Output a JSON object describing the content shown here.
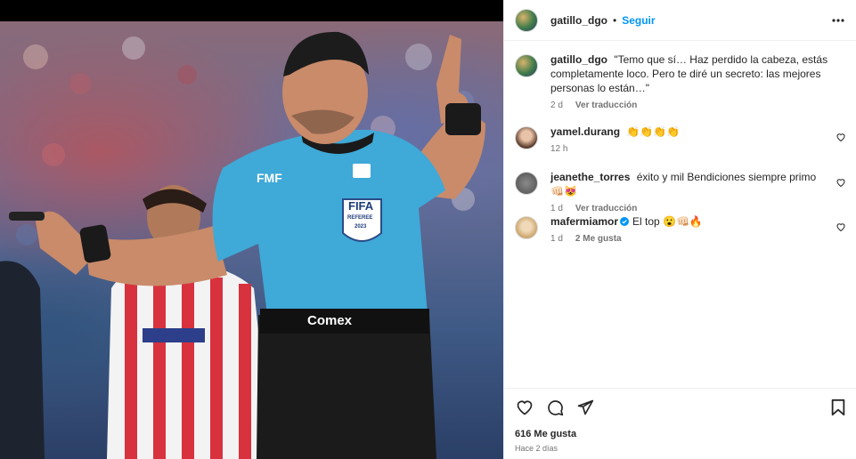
{
  "post": {
    "username": "gatillo_dgo",
    "separator": "•",
    "follow_label": "Seguir"
  },
  "photo": {
    "shirt_badge_text": "FMF",
    "fifa_badge": "FIFA",
    "referee_text": "REFEREE",
    "badge_year": "2023",
    "sponsor": "Comex"
  },
  "caption": {
    "username": "gatillo_dgo",
    "text": "\"Temo que sí… Haz perdido la cabeza, estás completamente loco. Pero te diré un secreto: las mejores personas lo están…\"",
    "age": "2 d",
    "translate_label": "Ver traducción"
  },
  "comments": [
    {
      "username": "yamel.durang",
      "text": "👏👏👏👏",
      "age": "12 h"
    },
    {
      "username": "jeanethe_torres",
      "text": "éxito y mil Bendiciones siempre primo 👊🏻😻",
      "age": "1 d",
      "translate_label": "Ver traducción"
    },
    {
      "username": "mafermiamor",
      "verified": true,
      "text": "El top 😮👊🏻🔥",
      "age": "1 d",
      "likes_label": "2 Me gusta"
    }
  ],
  "footer": {
    "likes": "616 Me gusta",
    "time": "Hace 2 días"
  },
  "icons": {
    "more": "more-options-icon",
    "heart": "heart-icon",
    "comment": "comment-icon",
    "share": "share-icon",
    "save": "bookmark-icon",
    "verified": "verified-badge-icon"
  },
  "colors": {
    "accent": "#0095f6",
    "text": "#262626",
    "secondary_text": "#737373",
    "border": "#efefef",
    "referee_shirt": "#3fa9d8"
  }
}
